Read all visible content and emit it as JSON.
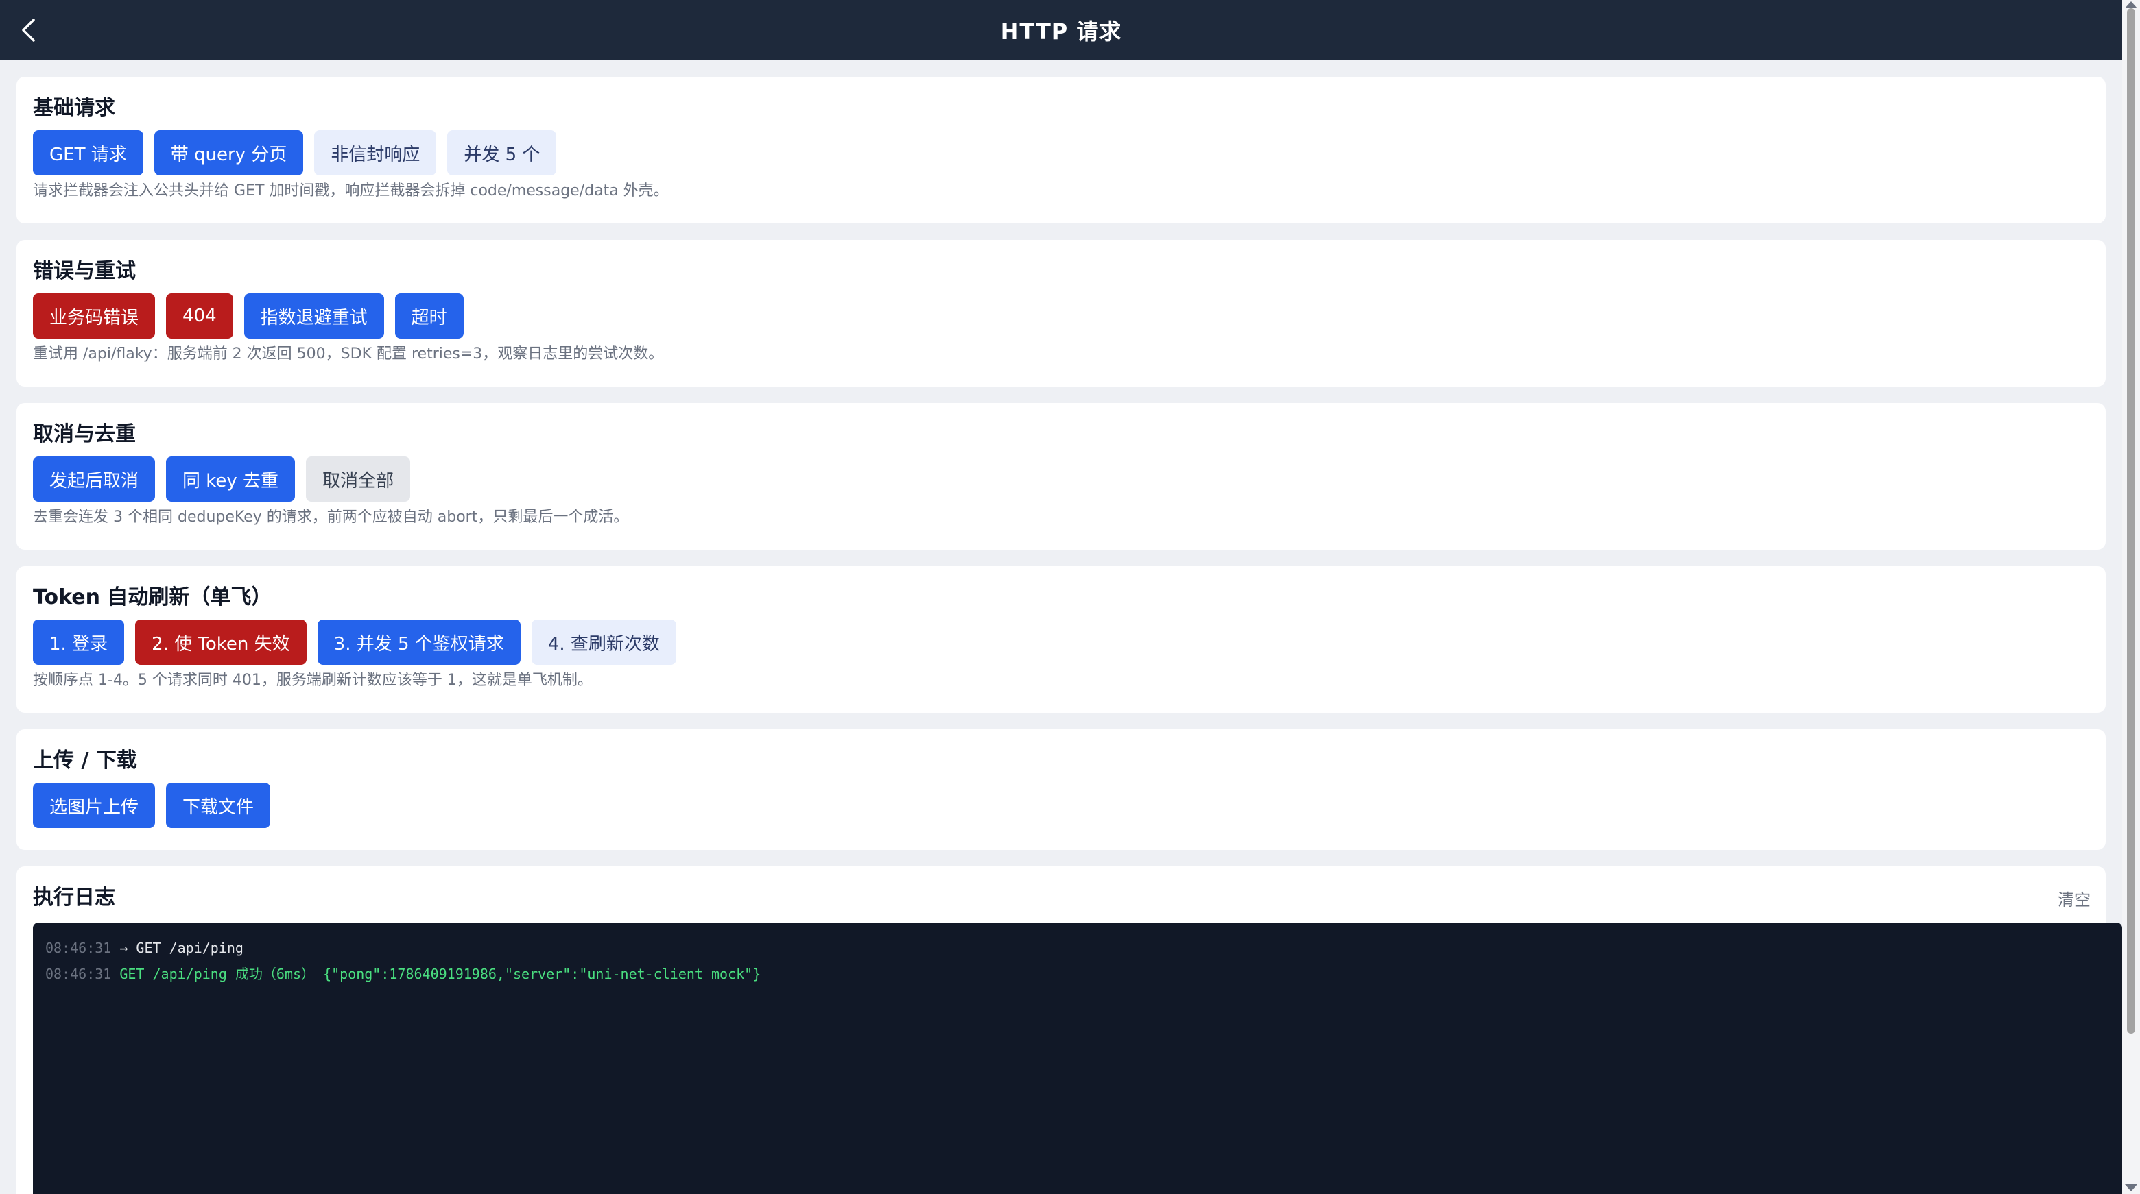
{
  "navbar": {
    "title": "HTTP 请求",
    "back_icon": "chevron-left-icon"
  },
  "sections": {
    "basic": {
      "title": "基础请求",
      "buttons": [
        "GET 请求",
        "带 query 分页",
        "非信封响应",
        "并发 5 个"
      ],
      "hint": "请求拦截器会注入公共头并给 GET 加时间戳，响应拦截器会拆掉 code/message/data 外壳。"
    },
    "error": {
      "title": "错误与重试",
      "buttons": [
        "业务码错误",
        "404",
        "指数退避重试",
        "超时"
      ],
      "hint": "重试用 /api/flaky：服务端前 2 次返回 500，SDK 配置 retries=3，观察日志里的尝试次数。"
    },
    "cancel": {
      "title": "取消与去重",
      "buttons": [
        "发起后取消",
        "同 key 去重",
        "取消全部"
      ],
      "hint": "去重会连发 3 个相同 dedupeKey 的请求，前两个应被自动 abort，只剩最后一个成活。"
    },
    "token": {
      "title": "Token 自动刷新（单飞）",
      "buttons": [
        "1. 登录",
        "2. 使 Token 失效",
        "3. 并发 5 个鉴权请求",
        "4. 查刷新次数"
      ],
      "hint": "按顺序点 1-4。5 个请求同时 401，服务端刷新计数应该等于 1，这就是单飞机制。"
    },
    "transfer": {
      "title": "上传 / 下载",
      "buttons": [
        "选图片上传",
        "下载文件"
      ]
    }
  },
  "log": {
    "title": "执行日志",
    "clear_label": "清空",
    "lines": [
      {
        "time": "08:46:31",
        "message": "→ GET /api/ping",
        "level": "info"
      },
      {
        "time": "08:46:31",
        "message": "GET /api/ping 成功（6ms） {\"pong\":1786409191986,\"server\":\"uni-net-client mock\"}",
        "level": "success"
      }
    ]
  },
  "colors": {
    "navbar": "#1e293b",
    "primary": "#2563eb",
    "danger": "#b91c1c",
    "soft": "#e8eefc",
    "log_bg": "#111827",
    "log_success": "#4ade80"
  }
}
